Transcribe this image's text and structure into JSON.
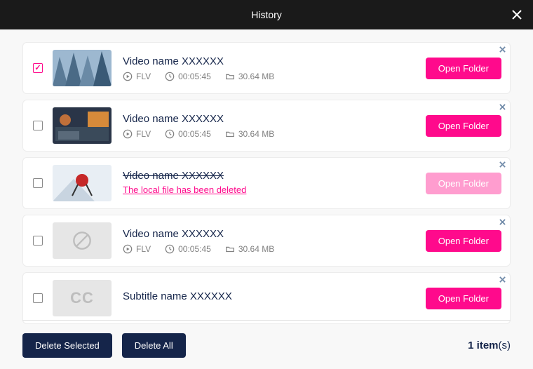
{
  "header": {
    "title": "History"
  },
  "rows": [
    {
      "checked": true,
      "title": "Video name XXXXXX",
      "format": "FLV",
      "duration": "00:05:45",
      "size": "30.64 MB",
      "open_label": "Open Folder",
      "deleted": false,
      "kind": "video",
      "thumb": "buildings"
    },
    {
      "checked": false,
      "title": "Video name XXXXXX",
      "format": "FLV",
      "duration": "00:05:45",
      "size": "30.64 MB",
      "open_label": "Open Folder",
      "deleted": false,
      "kind": "video",
      "thumb": "livingroom"
    },
    {
      "checked": false,
      "title": "Video name XXXXXX",
      "deleted_msg": "The local file has been deleted",
      "open_label": "Open Folder",
      "deleted": true,
      "kind": "video",
      "thumb": "skier"
    },
    {
      "checked": false,
      "title": "Video name XXXXXX",
      "format": "FLV",
      "duration": "00:05:45",
      "size": "30.64 MB",
      "open_label": "Open Folder",
      "deleted": false,
      "kind": "video",
      "thumb": "none"
    },
    {
      "checked": false,
      "title": "Subtitle name XXXXXX",
      "open_label": "Open Folder",
      "deleted": false,
      "kind": "subtitle",
      "thumb": "cc",
      "cc_label": "CC"
    }
  ],
  "footer": {
    "delete_selected": "Delete Selected",
    "delete_all": "Delete All",
    "count_num": "1",
    "count_unit": "item",
    "count_suffix": "(s)"
  }
}
